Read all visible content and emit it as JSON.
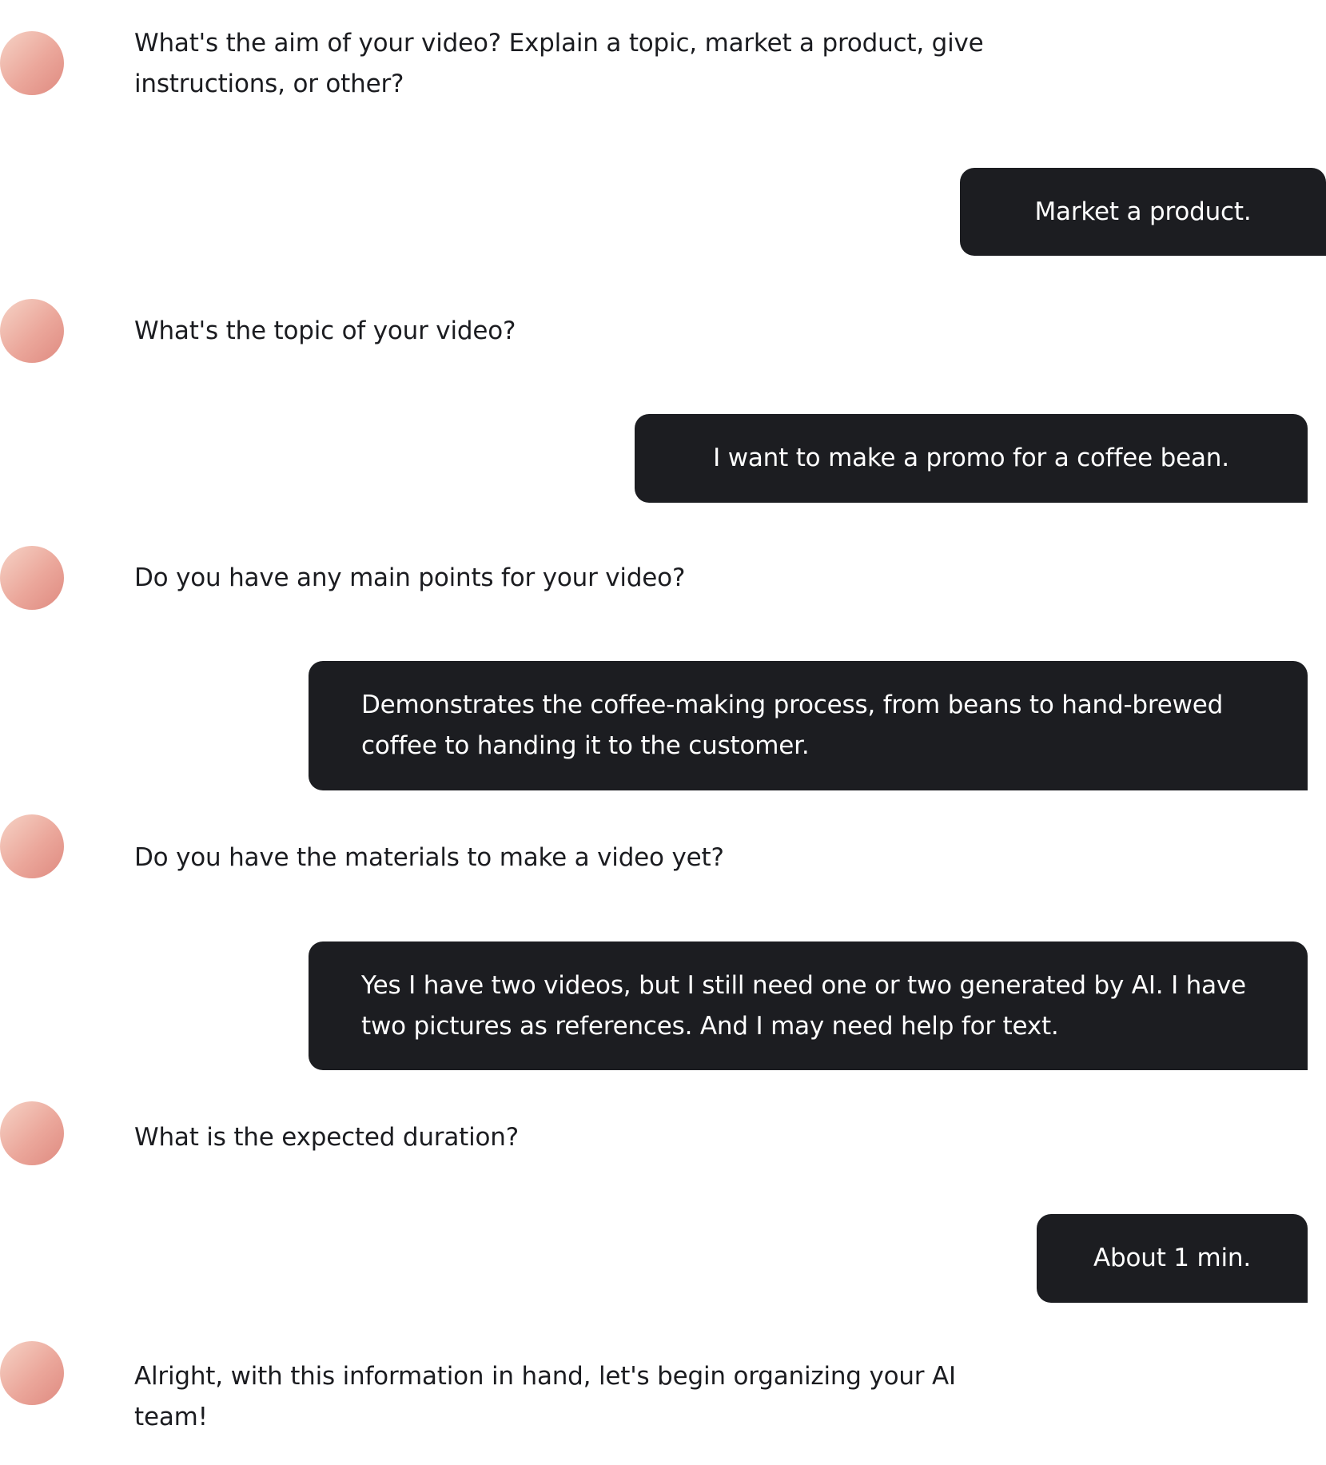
{
  "conversation": {
    "messages": [
      {
        "role": "assistant",
        "text": "What's the aim of your video? Explain a topic, market a product, give instructions, or other?"
      },
      {
        "role": "user",
        "text": "Market a product."
      },
      {
        "role": "assistant",
        "text": "What's the topic of your video?"
      },
      {
        "role": "user",
        "text": "I want to make a promo for a coffee bean."
      },
      {
        "role": "assistant",
        "text": "Do you have any main points for your video?"
      },
      {
        "role": "user",
        "text": "Demonstrates the coffee-making process, from beans to hand-brewed coffee to handing it to the customer."
      },
      {
        "role": "assistant",
        "text": "Do you have the materials to make a video yet?"
      },
      {
        "role": "user",
        "text": "Yes I have two videos, but I still need one or two generated by AI. I have two pictures as references. And I may need help for text."
      },
      {
        "role": "assistant",
        "text": "What is the expected duration?"
      },
      {
        "role": "user",
        "text": "About 1 min."
      },
      {
        "role": "assistant",
        "text": "Alright, with this information in hand, let's begin organizing your AI team!"
      }
    ]
  },
  "colors": {
    "user_bubble_bg": "#1c1d21",
    "user_bubble_text": "#ffffff",
    "assistant_text": "#1b1c20",
    "avatar_gradient_start": "#f6d3c6",
    "avatar_gradient_end": "#df8a80"
  }
}
